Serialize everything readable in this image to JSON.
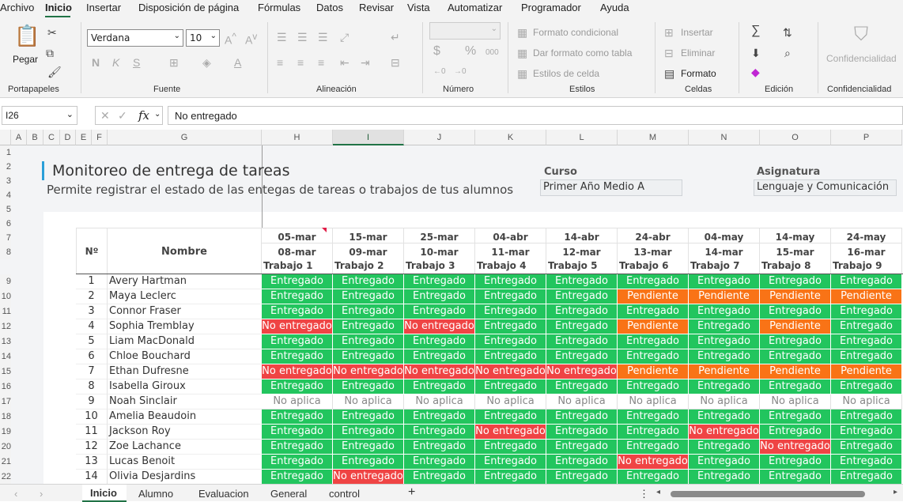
{
  "menu": {
    "items": [
      "Archivo",
      "Inicio",
      "Insertar",
      "Disposición de página",
      "Fórmulas",
      "Datos",
      "Revisar",
      "Vista",
      "Automatizar",
      "Programador",
      "Ayuda"
    ]
  },
  "ribbon": {
    "groups": [
      "Portapapeles",
      "Fuente",
      "Alineación",
      "Número",
      "Estilos",
      "Celdas",
      "Edición",
      "Confidencialidad"
    ],
    "paste_label": "Pegar",
    "font_name": "Verdana",
    "font_size": "10",
    "styles": {
      "conditional": "Formato condicional",
      "table": "Dar formato como tabla",
      "cell": "Estilos de celda"
    },
    "cells": {
      "insert": "Insertar",
      "delete": "Eliminar",
      "format": "Formato"
    },
    "confidentiality": "Confidencialidad"
  },
  "formula_bar": {
    "name_box": "I26",
    "formula": "No entregado"
  },
  "columns": {
    "small": [
      "A",
      "B",
      "C",
      "D",
      "E",
      "F"
    ],
    "g": "G",
    "tasks": [
      "H",
      "I",
      "J",
      "K",
      "L",
      "M",
      "N",
      "O",
      "P"
    ],
    "selected": "I"
  },
  "row_numbers": [
    "1",
    "2",
    "3",
    "4",
    "5",
    "6",
    "7",
    "8",
    "9",
    "10",
    "11",
    "12",
    "13",
    "14",
    "15",
    "16",
    "17",
    "18",
    "19",
    "20",
    "21",
    "22"
  ],
  "sheet": {
    "title": "Monitoreo de entrega de tareas",
    "subtitle": "Permite registrar el estado de las entegas de tareas o trabajos de tus alumnos",
    "course_label": "Curso",
    "course_value": "Primer Año Medio A",
    "subject_label": "Asignatura",
    "subject_value": "Lenguaje y Comunicación",
    "col_num": "Nº",
    "col_name": "Nombre",
    "tasks": [
      {
        "start": "05-mar",
        "end": "08-mar",
        "name": "Trabajo 1"
      },
      {
        "start": "15-mar",
        "end": "09-mar",
        "name": "Trabajo 2"
      },
      {
        "start": "25-mar",
        "end": "10-mar",
        "name": "Trabajo 3"
      },
      {
        "start": "04-abr",
        "end": "11-mar",
        "name": "Trabajo 4"
      },
      {
        "start": "14-abr",
        "end": "12-mar",
        "name": "Trabajo 5"
      },
      {
        "start": "24-abr",
        "end": "13-mar",
        "name": "Trabajo 6"
      },
      {
        "start": "04-may",
        "end": "14-mar",
        "name": "Trabajo 7"
      },
      {
        "start": "14-may",
        "end": "15-mar",
        "name": "Trabajo 8"
      },
      {
        "start": "24-may",
        "end": "16-mar",
        "name": "Trabajo 9"
      }
    ],
    "students": [
      {
        "n": "1",
        "name": "Avery Hartman",
        "s": [
          "E",
          "E",
          "E",
          "E",
          "E",
          "E",
          "E",
          "E",
          "E"
        ]
      },
      {
        "n": "2",
        "name": "Maya Leclerc",
        "s": [
          "E",
          "E",
          "E",
          "E",
          "E",
          "P",
          "P",
          "P",
          "P"
        ]
      },
      {
        "n": "3",
        "name": "Connor Fraser",
        "s": [
          "E",
          "E",
          "E",
          "E",
          "E",
          "E",
          "E",
          "E",
          "E"
        ]
      },
      {
        "n": "4",
        "name": "Sophia Tremblay",
        "s": [
          "N",
          "E",
          "N",
          "E",
          "E",
          "P",
          "E",
          "P",
          "E"
        ]
      },
      {
        "n": "5",
        "name": "Liam MacDonald",
        "s": [
          "E",
          "E",
          "E",
          "E",
          "E",
          "E",
          "E",
          "E",
          "E"
        ]
      },
      {
        "n": "6",
        "name": "Chloe Bouchard",
        "s": [
          "E",
          "E",
          "E",
          "E",
          "E",
          "E",
          "E",
          "E",
          "E"
        ]
      },
      {
        "n": "7",
        "name": "Ethan Dufresne",
        "s": [
          "N",
          "N",
          "N",
          "N",
          "N",
          "P",
          "P",
          "P",
          "P"
        ]
      },
      {
        "n": "8",
        "name": "Isabella Giroux",
        "s": [
          "E",
          "E",
          "E",
          "E",
          "E",
          "E",
          "E",
          "E",
          "E"
        ]
      },
      {
        "n": "9",
        "name": "Noah Sinclair",
        "s": [
          "A",
          "A",
          "A",
          "A",
          "A",
          "A",
          "A",
          "A",
          "A"
        ]
      },
      {
        "n": "10",
        "name": "Amelia Beaudoin",
        "s": [
          "E",
          "E",
          "E",
          "E",
          "E",
          "E",
          "E",
          "E",
          "E"
        ]
      },
      {
        "n": "11",
        "name": "Jackson Roy",
        "s": [
          "E",
          "E",
          "E",
          "N",
          "E",
          "E",
          "N",
          "E",
          "E"
        ]
      },
      {
        "n": "12",
        "name": "Zoe Lachance",
        "s": [
          "E",
          "E",
          "E",
          "E",
          "E",
          "E",
          "E",
          "N",
          "E"
        ]
      },
      {
        "n": "13",
        "name": "Lucas Benoit",
        "s": [
          "E",
          "E",
          "E",
          "E",
          "E",
          "N",
          "E",
          "E",
          "E"
        ]
      },
      {
        "n": "14",
        "name": "Olivia Desjardins",
        "s": [
          "E",
          "N",
          "E",
          "E",
          "E",
          "E",
          "E",
          "E",
          "E"
        ]
      }
    ],
    "status_text": {
      "E": "Entregado",
      "P": "Pendiente",
      "N": "No entregado",
      "A": "No aplica"
    },
    "status_colors": {
      "E": "#22c55e",
      "P": "#f97316",
      "N": "#ef4444",
      "A": "#ffffff"
    }
  },
  "sheet_tabs": [
    "Inicio",
    "Alumno",
    "Evaluacion",
    "General",
    "control"
  ]
}
